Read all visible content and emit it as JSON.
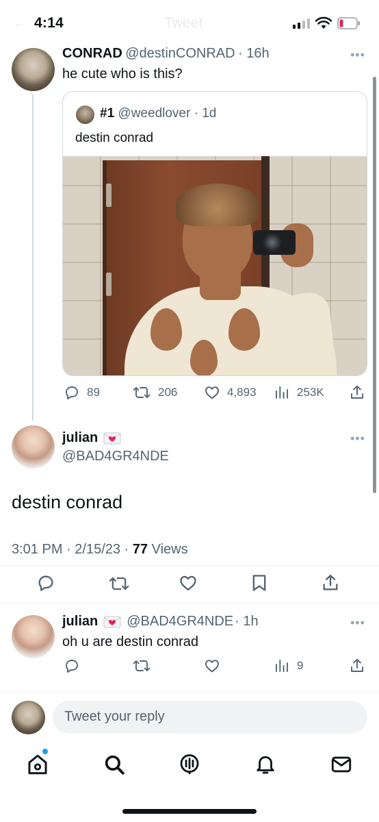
{
  "status_bar": {
    "time": "4:14",
    "ghost_back": "←",
    "ghost_title": "Tweet"
  },
  "parent_tweet": {
    "name": "CONRAD",
    "handle": "@destinCONRAD",
    "time": "· 16h",
    "text": "he cute who is this?",
    "more": "•••",
    "quote": {
      "name": "#1",
      "handle": "@weedlover",
      "time": "· 1d",
      "text": "destin conrad"
    },
    "replies": "89",
    "retweets": "206",
    "likes": "4,893",
    "views": "253K"
  },
  "main_tweet": {
    "name": "julian",
    "handle": "@BAD4GR4NDE",
    "text": "destin conrad",
    "time": "3:01 PM",
    "date": "· 2/15/23 ·",
    "views_count": "77",
    "views_label": "Views",
    "more": "•••"
  },
  "reply_tweet": {
    "name": "julian",
    "handle": "@BAD4GR4NDE",
    "time": "· 1h",
    "text": "oh u are destin conrad",
    "views": "9",
    "more": "•••"
  },
  "composer": {
    "placeholder": "Tweet your reply"
  },
  "tab_bar": {
    "items": [
      "home",
      "search",
      "spaces",
      "notifications",
      "messages"
    ],
    "active": "home",
    "accent_color": "#1d9bf0"
  }
}
